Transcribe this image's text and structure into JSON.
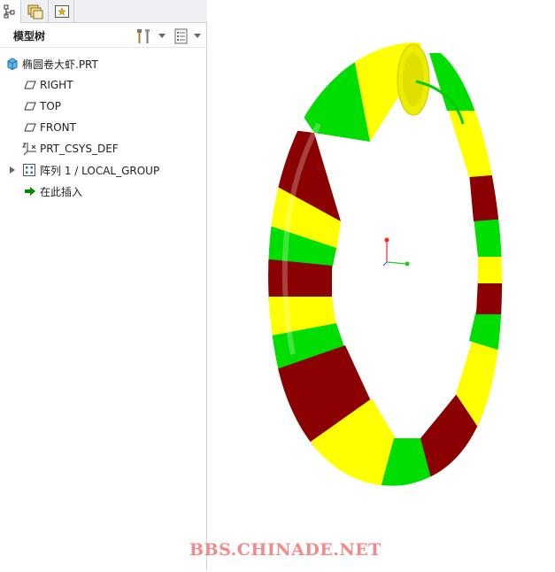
{
  "panel": {
    "title": "模型树"
  },
  "tree": {
    "part": "椭圆卷大虾.PRT",
    "items": [
      {
        "label": "RIGHT",
        "icon": "datum-plane-icon"
      },
      {
        "label": "TOP",
        "icon": "datum-plane-icon"
      },
      {
        "label": "FRONT",
        "icon": "datum-plane-icon"
      },
      {
        "label": "PRT_CSYS_DEF",
        "icon": "coordinate-system-icon"
      },
      {
        "label": "阵列 1 / LOCAL_GROUP",
        "icon": "pattern-icon"
      },
      {
        "label": "在此插入",
        "icon": "insert-here-arrow-icon"
      }
    ]
  },
  "watermark": "BBS.CHINADE.NET",
  "colors": {
    "green": "#00dd00",
    "yellow": "#ffff00",
    "dark_red": "#8b0000",
    "insert_arrow": "#008800"
  }
}
